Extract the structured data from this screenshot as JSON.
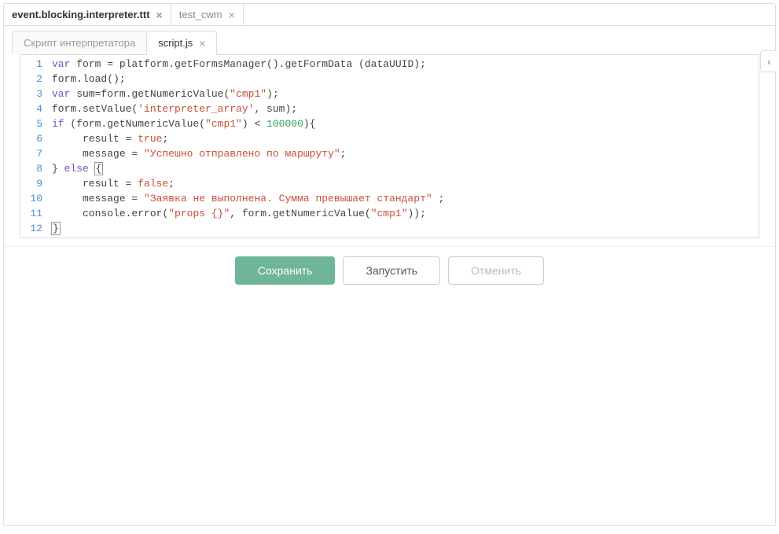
{
  "topTabs": [
    {
      "label": "event.blocking.interpreter.ttt",
      "active": true
    },
    {
      "label": "test_cwm",
      "active": false
    }
  ],
  "subTabs": [
    {
      "label": "Скрипт интерпретатора",
      "active": false,
      "closable": false
    },
    {
      "label": "script.js",
      "active": true,
      "closable": true
    }
  ],
  "code": {
    "lines": [
      [
        {
          "t": "var ",
          "c": "tok-kw"
        },
        {
          "t": "form = platform.getFormsManager().getFormData (dataUUID);",
          "c": ""
        }
      ],
      [
        {
          "t": "form.load();",
          "c": ""
        }
      ],
      [
        {
          "t": "var ",
          "c": "tok-kw"
        },
        {
          "t": "sum=form.getNumericValue(",
          "c": ""
        },
        {
          "t": "\"cmp1\"",
          "c": "tok-str"
        },
        {
          "t": ");",
          "c": ""
        }
      ],
      [
        {
          "t": "form.setValue(",
          "c": ""
        },
        {
          "t": "'interpreter_array'",
          "c": "tok-str"
        },
        {
          "t": ", sum);",
          "c": ""
        }
      ],
      [
        {
          "t": "if ",
          "c": "tok-kw"
        },
        {
          "t": "(form.getNumericValue(",
          "c": ""
        },
        {
          "t": "\"cmp1\"",
          "c": "tok-str"
        },
        {
          "t": ") < ",
          "c": ""
        },
        {
          "t": "100000",
          "c": "tok-num"
        },
        {
          "t": "){",
          "c": ""
        }
      ],
      [
        {
          "t": "     result = ",
          "c": ""
        },
        {
          "t": "true",
          "c": "tok-bool"
        },
        {
          "t": ";",
          "c": ""
        }
      ],
      [
        {
          "t": "     message = ",
          "c": ""
        },
        {
          "t": "\"Успешно отправлено по маршруту\"",
          "c": "tok-str"
        },
        {
          "t": ";",
          "c": ""
        }
      ],
      [
        {
          "t": "} ",
          "c": ""
        },
        {
          "t": "else ",
          "c": "tok-kw"
        },
        {
          "t": "{",
          "c": "cursor-box"
        }
      ],
      [
        {
          "t": "     result = ",
          "c": ""
        },
        {
          "t": "false",
          "c": "tok-bool"
        },
        {
          "t": ";",
          "c": ""
        }
      ],
      [
        {
          "t": "     message = ",
          "c": ""
        },
        {
          "t": "\"Заявка не выполнена. Сумма превышает стандарт\"",
          "c": "tok-str"
        },
        {
          "t": " ;",
          "c": ""
        }
      ],
      [
        {
          "t": "     console.error(",
          "c": ""
        },
        {
          "t": "\"props {}\"",
          "c": "tok-str"
        },
        {
          "t": ", form.getNumericValue(",
          "c": ""
        },
        {
          "t": "\"cmp1\"",
          "c": "tok-str"
        },
        {
          "t": "));",
          "c": ""
        }
      ],
      [
        {
          "t": "}",
          "c": "cursor-box"
        }
      ]
    ]
  },
  "buttons": {
    "save": "Сохранить",
    "run": "Запустить",
    "cancel": "Отменить"
  },
  "sideCollapseGlyph": "‹"
}
